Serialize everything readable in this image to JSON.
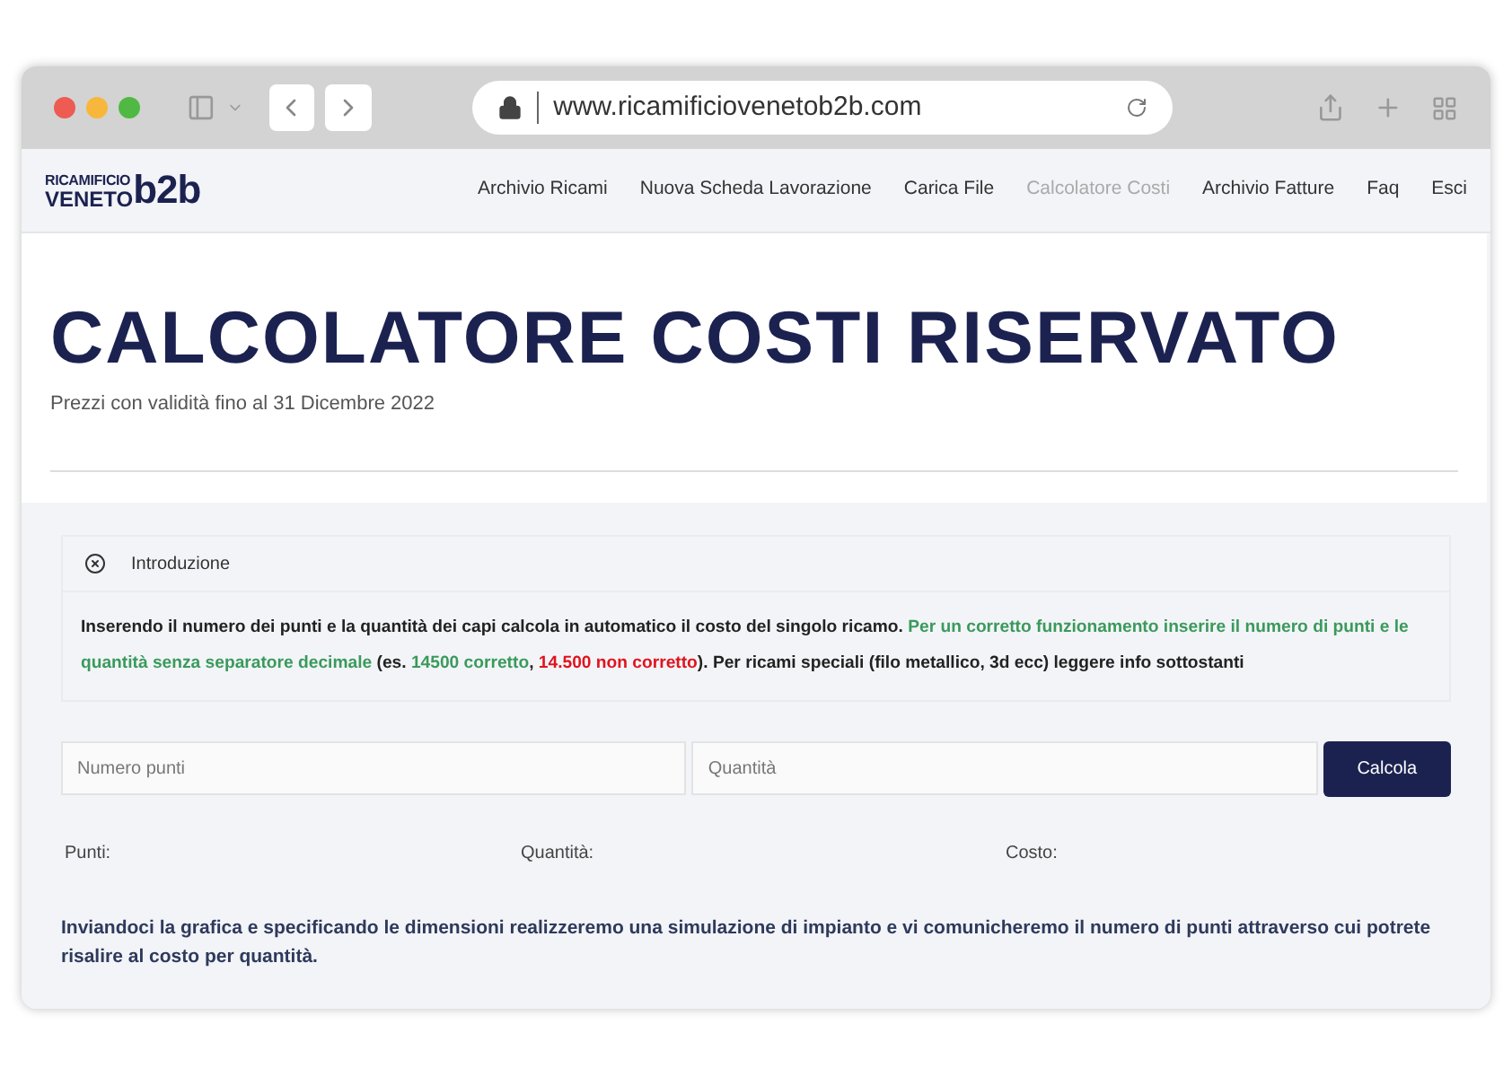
{
  "browser": {
    "url": "www.ricamificiovenetob2b.com"
  },
  "logo": {
    "line_1": "RICAMIFICIO",
    "line_2": "VENETO",
    "mark": "b2b"
  },
  "nav": [
    {
      "label": "Archivio Ricami",
      "selected": false
    },
    {
      "label": "Nuova Scheda Lavorazione",
      "selected": false
    },
    {
      "label": "Carica File",
      "selected": false
    },
    {
      "label": "Calcolatore Costi",
      "selected": true
    },
    {
      "label": "Archivio Fatture",
      "selected": false
    },
    {
      "label": "Faq",
      "selected": false
    },
    {
      "label": "Esci",
      "selected": false
    }
  ],
  "title": "CALCOLATORE COSTI RISERVATO",
  "subtitle": "Prezzi con validità fino al 31 Dicembre 2022",
  "intro": {
    "label": "Introduzione",
    "expanded": true,
    "segments": [
      {
        "kind": "strong",
        "text": "Inserendo il numero dei punti e la quantità dei capi calcola in automatico il costo del singolo ricamo. "
      },
      {
        "kind": "ok",
        "text": "Per un corretto funzionamento inserire il numero di punti e le quantità senza separatore decimale"
      },
      {
        "kind": "strong",
        "text": " (es. "
      },
      {
        "kind": "ok",
        "text": "14500 corretto"
      },
      {
        "kind": "strong",
        "text": ", "
      },
      {
        "kind": "error",
        "text": "14.500 non corretto"
      },
      {
        "kind": "strong",
        "text": "). Per ricami speciali (filo metallico, 3d ecc) leggere info sottostanti"
      }
    ]
  },
  "form": {
    "points_placeholder": "Numero punti",
    "quantity_placeholder": "Quantità",
    "button": "Calcola"
  },
  "results": [
    "Punti:",
    "Quantità:",
    "Costo:"
  ],
  "note": "Inviandoci la grafica e specificando le dimensioni realizzeremo una simulazione di impianto e vi comunicheremo il numero di punti attraverso cui potrete risalire al costo per quantità."
}
